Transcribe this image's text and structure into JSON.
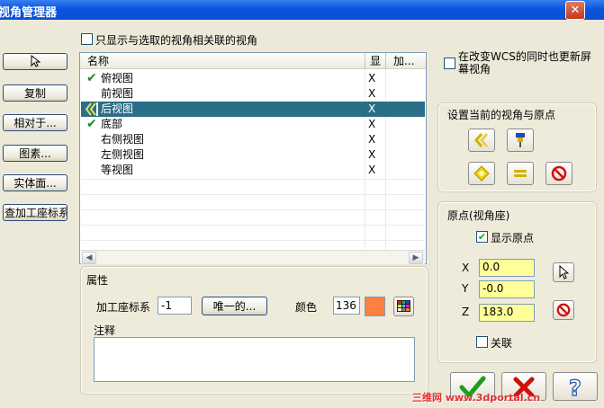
{
  "window": {
    "title": "视角管理器",
    "close_glyph": "✕"
  },
  "left_buttons": [
    "复制",
    "相对于...",
    "图素...",
    "实体面...",
    "查加工座标系"
  ],
  "filter": {
    "label": "只显示与选取的视角相关联的视角",
    "checked": false
  },
  "list": {
    "columns": [
      "名称",
      "显",
      "加..."
    ],
    "rows": [
      {
        "name": "俯视图",
        "show": "X",
        "mark": "check",
        "selected": false
      },
      {
        "name": "前视图",
        "show": "X",
        "mark": "",
        "selected": false
      },
      {
        "name": "后视图",
        "show": "X",
        "mark": "arrows",
        "selected": true
      },
      {
        "name": "底部",
        "show": "X",
        "mark": "check",
        "selected": false
      },
      {
        "name": "右侧视图",
        "show": "X",
        "mark": "",
        "selected": false
      },
      {
        "name": "左侧视图",
        "show": "X",
        "mark": "",
        "selected": false
      },
      {
        "name": "等视图",
        "show": "X",
        "mark": "",
        "selected": false
      }
    ]
  },
  "properties": {
    "title": "属性",
    "wcs_label": "加工座标系",
    "wcs_value": "-1",
    "unique_button": "唯一的...",
    "color_label": "颜色",
    "color_value": "136",
    "color_swatch": "#ff8040",
    "notes_label": "注释",
    "notes_value": ""
  },
  "update_wcs": {
    "label_line1": "在改变WCS的同时也更新屏",
    "label_line2": "幕视角",
    "checked": false
  },
  "set_view": {
    "title": "设置当前的视角与原点"
  },
  "origin": {
    "title": "原点(视角座)",
    "show_origin_label": "显示原点",
    "show_origin_checked": true,
    "x_label": "X",
    "x_value": "0.0",
    "y_label": "Y",
    "y_value": "-0.0",
    "z_label": "Z",
    "z_value": "183.0",
    "assoc_label": "关联",
    "assoc_checked": false
  },
  "watermark": "三维网 www.3dportal.cn",
  "colors": {
    "selection": "#2a6e88",
    "field_yellow": "#ffff99",
    "ok_green": "#1e9e1e",
    "cancel_red": "#d01010"
  }
}
